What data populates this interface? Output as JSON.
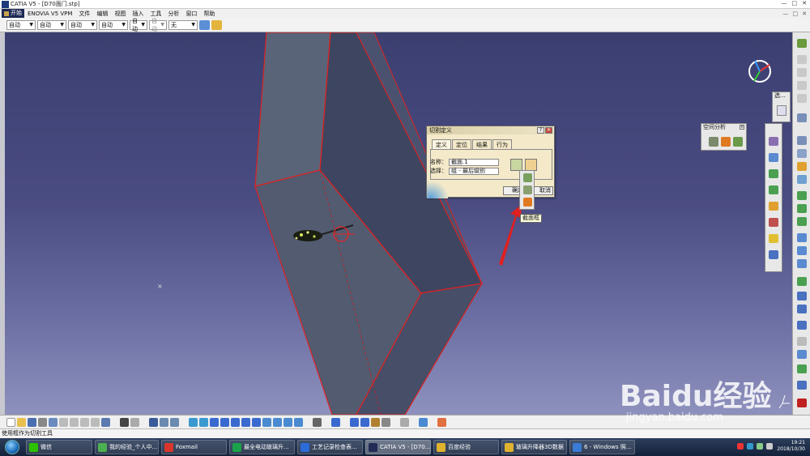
{
  "window": {
    "title": "CATIA V5 - [D70面门.stp]",
    "controls": [
      "—",
      "□",
      "✕"
    ]
  },
  "menu": {
    "start_label": "开始",
    "items": [
      "ENOVIA V5 VPM",
      "文件",
      "编辑",
      "视图",
      "插入",
      "工具",
      "分析",
      "窗口",
      "帮助"
    ],
    "doc_controls": [
      "—",
      "□",
      "✕"
    ]
  },
  "toolbar_top": {
    "combos": [
      "自动",
      "自动",
      "自动",
      "自动",
      "自动",
      "自动",
      "无"
    ]
  },
  "dialog": {
    "title": "切割定义",
    "title_buttons": [
      "?",
      "✕"
    ],
    "tabs": [
      "定义",
      "定位",
      "结果",
      "行为"
    ],
    "name_label": "名称：",
    "name_value": "截面.1",
    "selection_label": "选择：",
    "selection_value": "组 - 最后级别",
    "ok_label": "确定",
    "cancel_label": "取消"
  },
  "tooltip": {
    "text": "截面框"
  },
  "palette_space_analysis": {
    "title": "空间分析"
  },
  "palette_select": {
    "title": "选..."
  },
  "statusbar": {
    "text": "使用框作为切割工具"
  },
  "taskbar": {
    "tasks": [
      {
        "label": "微信",
        "color": "#2dc100"
      },
      {
        "label": "我的经验_个人中...",
        "color": "#4caf50"
      },
      {
        "label": "Foxmail",
        "color": "#d9362b"
      },
      {
        "label": "最全电动玻璃升...",
        "color": "#1aa34a"
      },
      {
        "label": "工艺记录检查表...",
        "color": "#2b6cd9"
      },
      {
        "label": "CATIA V5 - [D70...",
        "color": "#222c55"
      },
      {
        "label": "百度经验",
        "color": "#e0b22f"
      },
      {
        "label": "玻璃升降器3D数据",
        "color": "#e0b22f"
      },
      {
        "label": "6 - Windows 照...",
        "color": "#3a7bd5"
      }
    ],
    "time": "19:21",
    "date": "2018/10/30"
  },
  "watermark": {
    "main": "Baidu经验",
    "sub": "jingyan.baidu.com"
  }
}
